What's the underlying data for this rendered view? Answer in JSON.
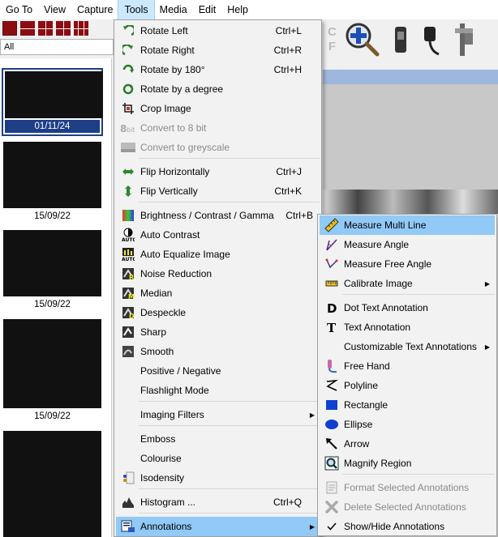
{
  "menubar": {
    "items": [
      "Go To",
      "View",
      "Capture",
      "Tools",
      "Media",
      "Edit",
      "Help"
    ],
    "active": "Tools"
  },
  "filter": {
    "value": "All"
  },
  "thumbnails": [
    {
      "date": "01/11/24",
      "selected": true
    },
    {
      "date": "15/09/22",
      "selected": false
    },
    {
      "date": "15/09/22",
      "selected": false
    },
    {
      "date": "15/09/22",
      "selected": false
    },
    {
      "date": "",
      "selected": false
    }
  ],
  "right_toolbar": {
    "c_label": "C",
    "f_label": "F"
  },
  "tools_menu": {
    "items": [
      {
        "label": "Rotate Left",
        "shortcut": "Ctrl+L",
        "icon": "rotate-left-icon"
      },
      {
        "label": "Rotate Right",
        "shortcut": "Ctrl+R",
        "icon": "rotate-right-icon"
      },
      {
        "label": "Rotate by 180°",
        "shortcut": "Ctrl+H",
        "icon": "rotate-180-icon"
      },
      {
        "label": "Rotate by a degree",
        "shortcut": "",
        "icon": "rotate-degree-icon"
      },
      {
        "label": "Crop Image",
        "shortcut": "",
        "icon": "crop-icon"
      },
      {
        "label": "Convert to 8 bit",
        "shortcut": "",
        "icon": "8bit-icon",
        "disabled": true
      },
      {
        "label": "Convert to greyscale",
        "shortcut": "",
        "icon": "grey-icon",
        "disabled": true
      },
      {
        "label": "Flip Horizontally",
        "shortcut": "Ctrl+J",
        "icon": "flip-horizontal-icon"
      },
      {
        "label": "Flip Vertically",
        "shortcut": "Ctrl+K",
        "icon": "flip-vertical-icon"
      },
      {
        "label": "Brightness / Contrast / Gamma",
        "shortcut": "Ctrl+B",
        "icon": "brightness-icon"
      },
      {
        "label": "Auto Contrast",
        "shortcut": "",
        "icon": "auto-contrast-icon"
      },
      {
        "label": "Auto Equalize Image",
        "shortcut": "",
        "icon": "auto-equalize-icon"
      },
      {
        "label": "Noise Reduction",
        "shortcut": "",
        "icon": "noise-reduction-icon"
      },
      {
        "label": "Median",
        "shortcut": "",
        "icon": "median-icon"
      },
      {
        "label": "Despeckle",
        "shortcut": "",
        "icon": "despeckle-icon"
      },
      {
        "label": "Sharp",
        "shortcut": "",
        "icon": "sharp-icon"
      },
      {
        "label": "Smooth",
        "shortcut": "",
        "icon": "smooth-icon"
      },
      {
        "label": "Positive / Negative",
        "shortcut": "",
        "icon": ""
      },
      {
        "label": "Flashlight Mode",
        "shortcut": "",
        "icon": ""
      },
      {
        "label": "Imaging Filters",
        "shortcut": "",
        "icon": "",
        "submenu": true
      },
      {
        "label": "Emboss",
        "shortcut": "",
        "icon": ""
      },
      {
        "label": "Colourise",
        "shortcut": "",
        "icon": ""
      },
      {
        "label": "Isodensity",
        "shortcut": "",
        "icon": "isodensity-icon"
      },
      {
        "label": "Histogram ...",
        "shortcut": "Ctrl+Q",
        "icon": "histogram-icon"
      },
      {
        "label": "Annotations",
        "shortcut": "",
        "icon": "annotations-icon",
        "submenu": true,
        "highlighted": true
      }
    ]
  },
  "annotations_menu": {
    "items": [
      {
        "label": "Measure Multi Line",
        "icon": "ruler-icon",
        "highlighted": true
      },
      {
        "label": "Measure Angle",
        "icon": "angle-icon"
      },
      {
        "label": "Measure Free Angle",
        "icon": "free-angle-icon"
      },
      {
        "label": "Calibrate Image",
        "icon": "calibrate-icon",
        "submenu": true
      },
      {
        "label": "Dot Text Annotation",
        "icon": "dot-text-icon"
      },
      {
        "label": "Text Annotation",
        "icon": "text-icon"
      },
      {
        "label": "Customizable Text Annotations",
        "icon": "",
        "submenu": true
      },
      {
        "label": "Free Hand",
        "icon": "free-hand-icon"
      },
      {
        "label": "Polyline",
        "icon": "polyline-icon"
      },
      {
        "label": "Rectangle",
        "icon": "rectangle-icon"
      },
      {
        "label": "Ellipse",
        "icon": "ellipse-icon"
      },
      {
        "label": "Arrow",
        "icon": "arrow-icon"
      },
      {
        "label": "Magnify Region",
        "icon": "magnify-region-icon"
      },
      {
        "label": "Format Selected Annotations",
        "icon": "format-icon",
        "disabled": true
      },
      {
        "label": "Delete Selected Annotations",
        "icon": "delete-icon",
        "disabled": true
      },
      {
        "label": "Show/Hide Annotations",
        "icon": "checkmark-icon"
      }
    ]
  }
}
